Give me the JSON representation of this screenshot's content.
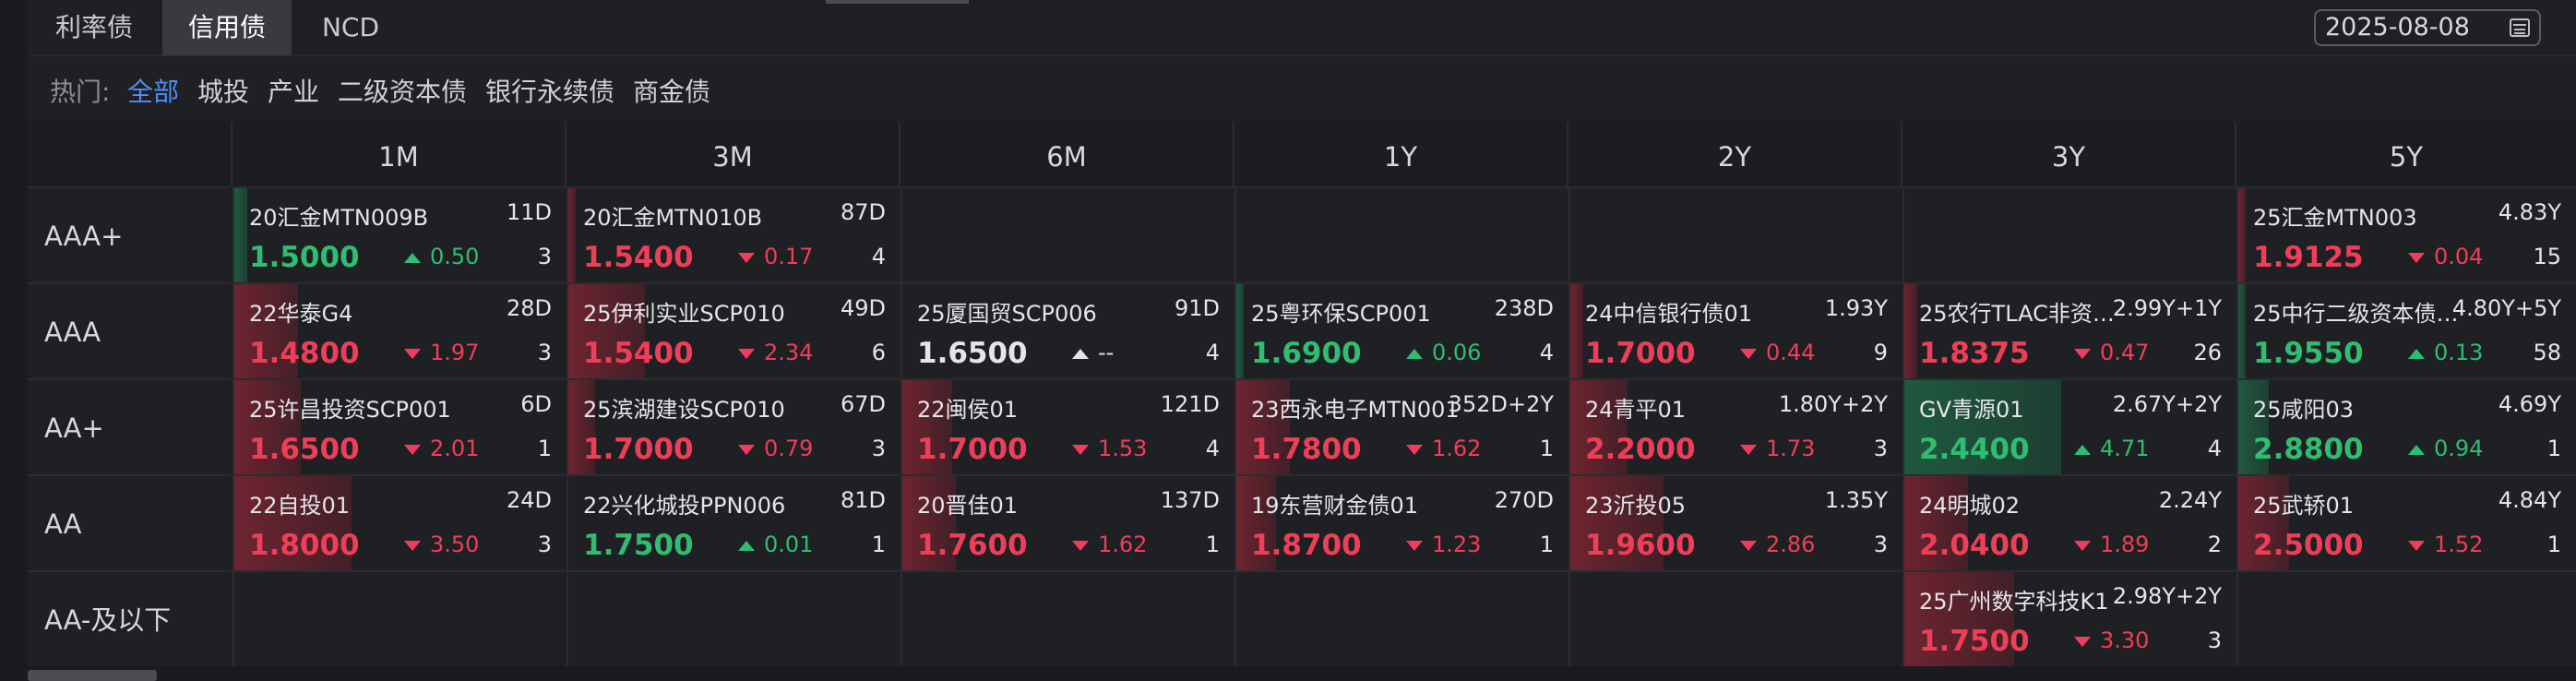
{
  "tabs": [
    {
      "label": "利率债",
      "active": false
    },
    {
      "label": "信用债",
      "active": true
    },
    {
      "label": "NCD",
      "active": false
    }
  ],
  "date": {
    "value": "2025-08-08",
    "icon": "calendar-icon"
  },
  "hot": {
    "label": "热门:",
    "items": [
      {
        "label": "全部",
        "active": true
      },
      {
        "label": "城投",
        "active": false
      },
      {
        "label": "产业",
        "active": false
      },
      {
        "label": "二级资本债",
        "active": false
      },
      {
        "label": "银行永续债",
        "active": false
      },
      {
        "label": "商金债",
        "active": false
      }
    ]
  },
  "columns": [
    "1M",
    "3M",
    "6M",
    "1Y",
    "2Y",
    "3Y",
    "5Y"
  ],
  "rows": [
    "AAA+",
    "AAA",
    "AA+",
    "AA",
    "AA-及以下"
  ],
  "colors": {
    "up": "#2fbd71",
    "down": "#f03e58",
    "flat": "#e4e5e8",
    "accent": "#4f8ff7"
  },
  "cells": [
    [
      {
        "name": "20汇金MTN009B",
        "term": "11D",
        "yield": "1.5000",
        "dir": "up",
        "change": "0.50",
        "count": "3",
        "heat": 0.04
      },
      {
        "name": "20汇金MTN010B",
        "term": "87D",
        "yield": "1.5400",
        "dir": "down",
        "change": "0.17",
        "count": "4",
        "heat": 0.02
      },
      null,
      null,
      null,
      null,
      {
        "name": "25汇金MTN003",
        "term": "4.83Y",
        "yield": "1.9125",
        "dir": "down",
        "change": "0.04",
        "count": "15",
        "heat": 0.01
      }
    ],
    [
      {
        "name": "22华泰G4",
        "term": "28D",
        "yield": "1.4800",
        "dir": "down",
        "change": "1.97",
        "count": "3",
        "heat": 0.19
      },
      {
        "name": "25伊利实业SCP010",
        "term": "49D",
        "yield": "1.5400",
        "dir": "down",
        "change": "2.34",
        "count": "6",
        "heat": 0.23
      },
      {
        "name": "25厦国贸SCP006",
        "term": "91D",
        "yield": "1.6500",
        "dir": "flat",
        "change": "--",
        "count": "4",
        "heat": 0
      },
      {
        "name": "25粤环保SCP001",
        "term": "238D",
        "yield": "1.6900",
        "dir": "up",
        "change": "0.06",
        "count": "4",
        "heat": 0.01
      },
      {
        "name": "24中信银行债01",
        "term": "1.93Y",
        "yield": "1.7000",
        "dir": "down",
        "change": "0.44",
        "count": "9",
        "heat": 0.04
      },
      {
        "name": "25农行TLAC非资…",
        "term": "2.99Y+1Y",
        "yield": "1.8375",
        "dir": "down",
        "change": "0.47",
        "count": "26",
        "heat": 0.04
      },
      {
        "name": "25中行二级资本债…",
        "term": "4.80Y+5Y",
        "yield": "1.9550",
        "dir": "up",
        "change": "0.13",
        "count": "58",
        "heat": 0.01
      }
    ],
    [
      {
        "name": "25许昌投资SCP001",
        "term": "6D",
        "yield": "1.6500",
        "dir": "down",
        "change": "2.01",
        "count": "1",
        "heat": 0.2
      },
      {
        "name": "25滨湖建设SCP010",
        "term": "67D",
        "yield": "1.7000",
        "dir": "down",
        "change": "0.79",
        "count": "3",
        "heat": 0.08
      },
      {
        "name": "22闽侯01",
        "term": "121D",
        "yield": "1.7000",
        "dir": "down",
        "change": "1.53",
        "count": "4",
        "heat": 0.15
      },
      {
        "name": "23西永电子MTN001",
        "term": "352D+2Y",
        "yield": "1.7800",
        "dir": "down",
        "change": "1.62",
        "count": "1",
        "heat": 0.16
      },
      {
        "name": "24青平01",
        "term": "1.80Y+2Y",
        "yield": "2.2000",
        "dir": "down",
        "change": "1.73",
        "count": "3",
        "heat": 0.17
      },
      {
        "name": "GV青源01",
        "term": "2.67Y+2Y",
        "yield": "2.4400",
        "dir": "up",
        "change": "4.71",
        "count": "4",
        "heat": 0.47
      },
      {
        "name": "25咸阳03",
        "term": "4.69Y",
        "yield": "2.8800",
        "dir": "up",
        "change": "0.94",
        "count": "1",
        "heat": 0.09
      }
    ],
    [
      {
        "name": "22自投01",
        "term": "24D",
        "yield": "1.8000",
        "dir": "down",
        "change": "3.50",
        "count": "3",
        "heat": 0.35
      },
      {
        "name": "22兴化城投PPN006",
        "term": "81D",
        "yield": "1.7500",
        "dir": "up",
        "change": "0.01",
        "count": "1",
        "heat": 0
      },
      {
        "name": "20晋佳01",
        "term": "137D",
        "yield": "1.7600",
        "dir": "down",
        "change": "1.62",
        "count": "1",
        "heat": 0.16
      },
      {
        "name": "19东营财金债01",
        "term": "270D",
        "yield": "1.8700",
        "dir": "down",
        "change": "1.23",
        "count": "1",
        "heat": 0.12
      },
      {
        "name": "23沂投05",
        "term": "1.35Y",
        "yield": "1.9600",
        "dir": "down",
        "change": "2.86",
        "count": "3",
        "heat": 0.28
      },
      {
        "name": "24明城02",
        "term": "2.24Y",
        "yield": "2.0400",
        "dir": "down",
        "change": "1.89",
        "count": "2",
        "heat": 0.19
      },
      {
        "name": "25武轿01",
        "term": "4.84Y",
        "yield": "2.5000",
        "dir": "down",
        "change": "1.52",
        "count": "1",
        "heat": 0.15
      }
    ],
    [
      null,
      null,
      null,
      null,
      null,
      {
        "name": "25广州数字科技K1",
        "term": "2.98Y+2Y",
        "yield": "1.7500",
        "dir": "down",
        "change": "3.30",
        "count": "3",
        "heat": 0.33
      },
      null
    ]
  ]
}
